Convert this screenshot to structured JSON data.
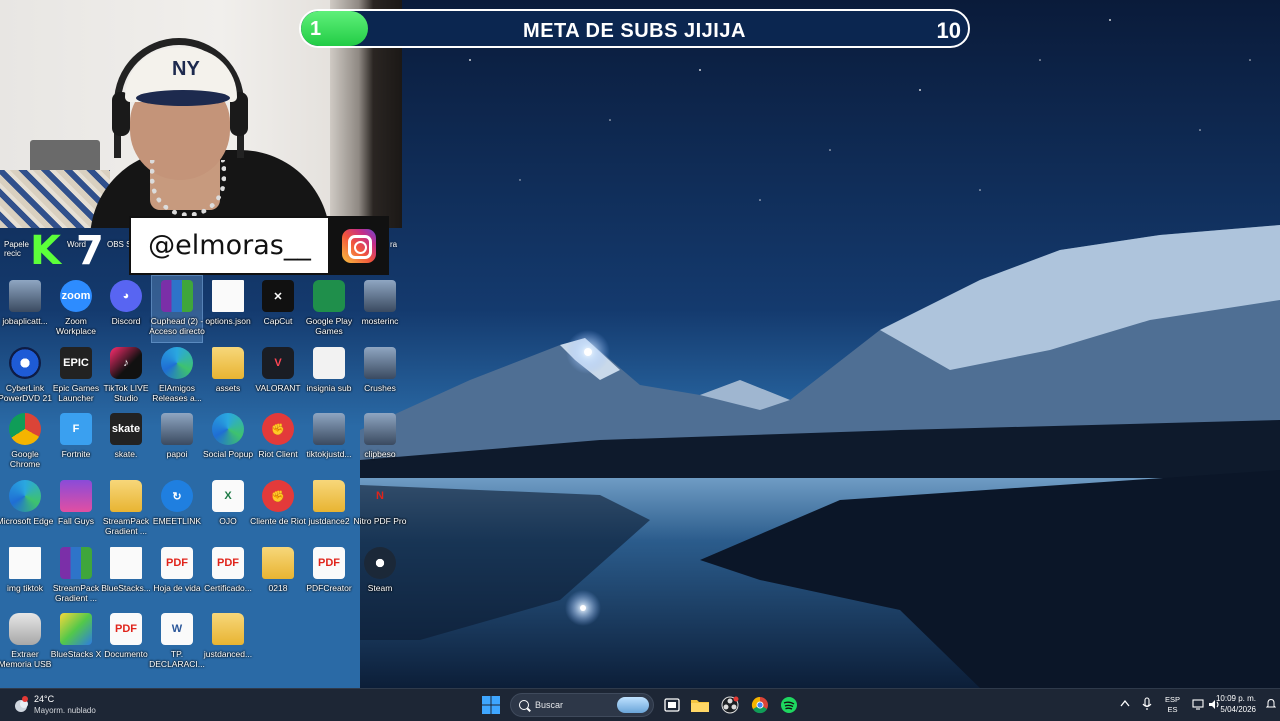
{
  "overlay": {
    "goal": {
      "start": "1",
      "title": "META DE SUBS JIJIJA",
      "end": "10",
      "progress": 0.1
    },
    "logo_k": "K",
    "logo_7": "7",
    "instagram_handle": "@elmoras__"
  },
  "partial_labels": {
    "papelera": "Papele\nrecic",
    "word": "Word",
    "obs": "OBS S",
    "ra": "ra"
  },
  "desktop_icons": [
    {
      "label": "jobaplicatt...",
      "icon": "photo-icon"
    },
    {
      "label": "Zoom Workplace",
      "icon": "zoom-icon"
    },
    {
      "label": "Discord",
      "icon": "discord-icon"
    },
    {
      "label": "Cuphead (2) - Acceso directo",
      "icon": "winrar-icon"
    },
    {
      "label": "options.json",
      "icon": "file-icon"
    },
    {
      "label": "CapCut",
      "icon": "capcut-icon"
    },
    {
      "label": "Google Play Games",
      "icon": "play-games-icon"
    },
    {
      "label": "mosterinc",
      "icon": "photo-icon"
    },
    {
      "label": "CyberLink PowerDVD 21",
      "icon": "powerdvd-icon"
    },
    {
      "label": "Epic Games Launcher",
      "icon": "epic-icon"
    },
    {
      "label": "TikTok LIVE Studio",
      "icon": "tiktok-icon"
    },
    {
      "label": "ElAmigos Releases a...",
      "icon": "edge-icon"
    },
    {
      "label": "assets",
      "icon": "folder-icon"
    },
    {
      "label": "VALORANT",
      "icon": "valorant-icon"
    },
    {
      "label": "insignia sub",
      "icon": "image-icon"
    },
    {
      "label": "Crushes",
      "icon": "photo-icon"
    },
    {
      "label": "Google Chrome",
      "icon": "chrome-icon"
    },
    {
      "label": "Fortnite",
      "icon": "fortnite-icon"
    },
    {
      "label": "skate.",
      "icon": "skate-icon"
    },
    {
      "label": "papoi",
      "icon": "photo-icon"
    },
    {
      "label": "Social Popup",
      "icon": "edge-icon"
    },
    {
      "label": "Riot Client",
      "icon": "riot-icon"
    },
    {
      "label": "tiktokjustd...",
      "icon": "photo-icon"
    },
    {
      "label": "clipbeso",
      "icon": "photo-icon"
    },
    {
      "label": "Microsoft Edge",
      "icon": "edge-icon"
    },
    {
      "label": "Fall Guys",
      "icon": "fallguys-icon"
    },
    {
      "label": "StreamPack Gradient ...",
      "icon": "folder-icon"
    },
    {
      "label": "EMEETLINK",
      "icon": "emeet-icon"
    },
    {
      "label": "OJO",
      "icon": "excel-icon"
    },
    {
      "label": "Cliente de Riot",
      "icon": "riot-icon"
    },
    {
      "label": "justdance2",
      "icon": "folder-icon"
    },
    {
      "label": "Nitro PDF Pro",
      "icon": "nitro-icon"
    },
    {
      "label": "img tiktok",
      "icon": "file-icon"
    },
    {
      "label": "StreamPack Gradient ...",
      "icon": "winrar-icon"
    },
    {
      "label": "BlueStacks...",
      "icon": "file-icon"
    },
    {
      "label": "Hoja de vida",
      "icon": "pdf-icon"
    },
    {
      "label": "Certificado...",
      "icon": "pdf-icon"
    },
    {
      "label": "0218",
      "icon": "folder-icon"
    },
    {
      "label": "PDFCreator",
      "icon": "pdfcreator-icon"
    },
    {
      "label": "Steam",
      "icon": "steam-icon"
    },
    {
      "label": "Extraer Memoria USB",
      "icon": "usb-icon"
    },
    {
      "label": "BlueStacks X",
      "icon": "bluestacks-icon"
    },
    {
      "label": "Documento",
      "icon": "pdf-icon"
    },
    {
      "label": "TP. DECLARACI...",
      "icon": "word-icon"
    },
    {
      "label": "justdanced...",
      "icon": "folder-icon"
    }
  ],
  "taskbar": {
    "weather": {
      "temp": "24°C",
      "desc": "Mayorm. nublado"
    },
    "search_placeholder": "Buscar",
    "lang_top": "ESP",
    "lang_bottom": "ES",
    "time": "10:09 p. m.",
    "date": "5/04/2026"
  }
}
